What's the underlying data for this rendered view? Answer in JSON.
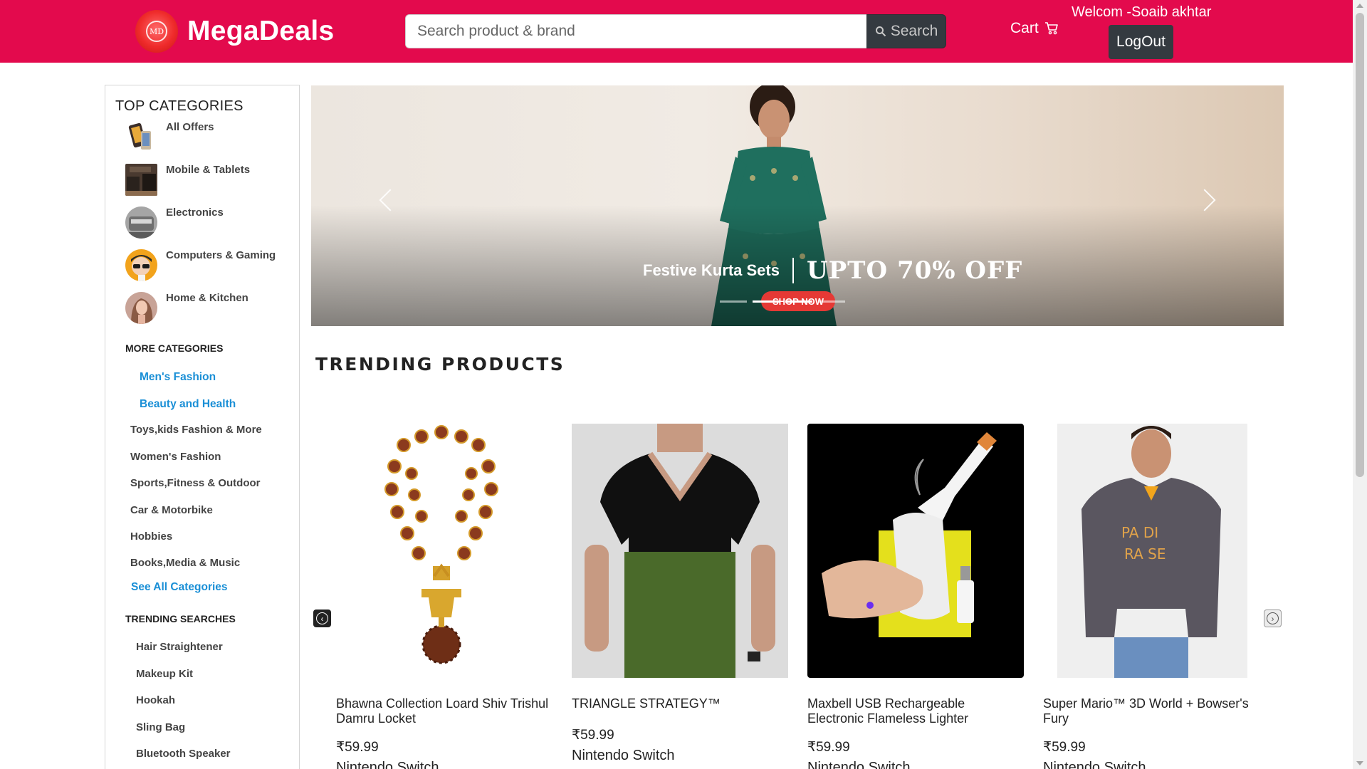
{
  "header": {
    "brand": "MegaDeals",
    "logo_text": "MD",
    "search_placeholder": "Search product & brand",
    "search_button": "Search",
    "cart_label": "Cart",
    "welcome": "Welcom -Soaib akhtar",
    "logout": "LogOut",
    "brand_color": "#e30a4d"
  },
  "sidebar": {
    "title": "TOP CATEGORIES",
    "top_categories": [
      {
        "label": "All Offers"
      },
      {
        "label": "Mobile & Tablets"
      },
      {
        "label": "Electronics"
      },
      {
        "label": "Computers & Gaming"
      },
      {
        "label": "Home & Kitchen"
      }
    ],
    "more_heading": "MORE CATEGORIES",
    "more_categories": [
      {
        "label": "Men's Fashion"
      },
      {
        "label": "Beauty and Health"
      },
      {
        "label": "Toys,kids Fashion & More"
      },
      {
        "label": "Women's Fashion"
      },
      {
        "label": "Sports,Fitness & Outdoor"
      },
      {
        "label": "Car & Motorbike"
      },
      {
        "label": "Hobbies"
      },
      {
        "label": "Books,Media & Music"
      }
    ],
    "see_all": "See All Categories",
    "trending_heading": "TRENDING SEARCHES",
    "trending_searches": [
      {
        "label": "Hair Straightener"
      },
      {
        "label": "Makeup Kit"
      },
      {
        "label": "Hookah"
      },
      {
        "label": "Sling Bag"
      },
      {
        "label": "Bluetooth Speaker"
      }
    ]
  },
  "banner": {
    "subtitle": "Festive Kurta Sets",
    "headline": "UPTO 70% OFF",
    "cta": "SHOP NOW",
    "slide_count": 4,
    "active_slide": 2
  },
  "trending": {
    "title": "TRENDING PRODUCTS",
    "products": [
      {
        "name": "Bhawna Collection Loard Shiv Trishul Damru Locket",
        "price": "₹59.99",
        "platform": "Nintendo Switch"
      },
      {
        "name": "TRIANGLE STRATEGY™",
        "price": "₹59.99",
        "platform": "Nintendo Switch"
      },
      {
        "name": "Maxbell USB Rechargeable Electronic Flameless Lighter",
        "price": "₹59.99",
        "platform": "Nintendo Switch"
      },
      {
        "name": "Super Mario™ 3D World + Bowser's Fury",
        "price": "₹59.99",
        "platform": "Nintendo Switch"
      }
    ]
  }
}
